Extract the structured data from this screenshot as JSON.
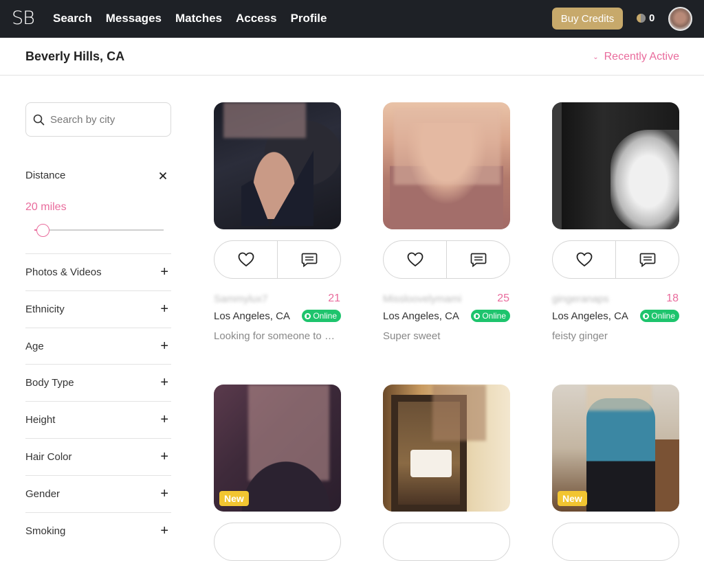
{
  "nav": {
    "logo": "SB",
    "links": [
      "Search",
      "Messages",
      "Matches",
      "Access",
      "Profile"
    ],
    "buy_credits": "Buy Credits",
    "credits_count": "0",
    "icons": {
      "coin": "coin-icon",
      "avatar": "user-avatar"
    }
  },
  "header": {
    "location": "Beverly Hills, CA",
    "sort_label": "Recently Active",
    "sort_icon": "chevron-down-icon"
  },
  "sidebar": {
    "search": {
      "placeholder": "Search by city",
      "value": ""
    },
    "distance": {
      "label": "Distance",
      "value_label": "20 miles",
      "value": 20,
      "slider_fraction": 0.06
    },
    "filters": [
      {
        "label": "Photos & Videos"
      },
      {
        "label": "Ethnicity"
      },
      {
        "label": "Age"
      },
      {
        "label": "Body Type"
      },
      {
        "label": "Height"
      },
      {
        "label": "Hair Color"
      },
      {
        "label": "Gender"
      },
      {
        "label": "Smoking"
      }
    ]
  },
  "colors": {
    "accent_pink": "#e96b9c",
    "gold": "#c7a96b",
    "online_green": "#1ec46d",
    "new_badge": "#f2c531",
    "nav_bg": "#1e2126"
  },
  "cards": [
    {
      "username": "Sammylux7",
      "age": "21",
      "city": "Los Angeles, CA",
      "status": "Online",
      "tagline": "Looking for someone to Sp...",
      "badge": ""
    },
    {
      "username": "Missloovelymami",
      "age": "25",
      "city": "Los Angeles, CA",
      "status": "Online",
      "tagline": "Super sweet",
      "badge": ""
    },
    {
      "username": "gingeranaps",
      "age": "18",
      "city": "Los Angeles, CA",
      "status": "Online",
      "tagline": "feisty ginger",
      "badge": ""
    },
    {
      "badge": "New"
    },
    {
      "badge": ""
    },
    {
      "badge": "New"
    }
  ]
}
